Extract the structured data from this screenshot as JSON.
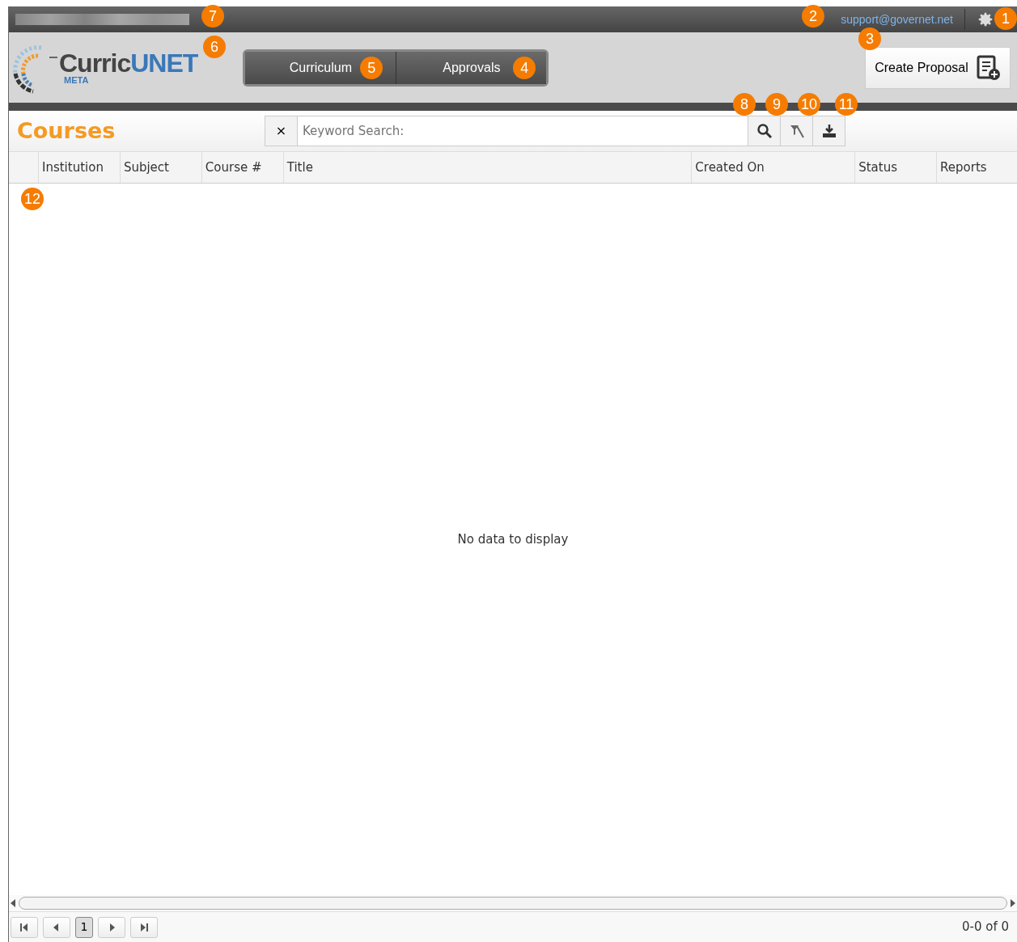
{
  "top_bar": {
    "support_email": "support@governet.net",
    "email_callout": "2",
    "settings_callout": "1",
    "blurred_callout": "7"
  },
  "header": {
    "logo": {
      "name_part1": "Curric",
      "name_part2": "UNET",
      "sub": "META",
      "callout": "6"
    },
    "nav_tabs": [
      {
        "label": "Curriculum",
        "callout": "5"
      },
      {
        "label": "Approvals",
        "callout": "4"
      }
    ],
    "create_button": {
      "label": "Create Proposal",
      "callout": "3"
    }
  },
  "toolbar": {
    "title": "Courses",
    "clear": "×",
    "search": {
      "placeholder": "Keyword Search:"
    },
    "tools": [
      {
        "kind": "search",
        "callout": "8"
      },
      {
        "kind": "clear-filter",
        "callout": "9"
      },
      {
        "kind": "export",
        "callout": "10"
      }
    ],
    "extra_callout": "11"
  },
  "table": {
    "columns": [
      "Institution",
      "Subject",
      "Course #",
      "Title",
      "Created On",
      "Status",
      "Reports"
    ],
    "callout": "12",
    "empty_text": "No data to display"
  },
  "pager": {
    "pages": [
      {
        "label": "1",
        "selected": true
      }
    ],
    "summary": "0-0 of 0"
  }
}
